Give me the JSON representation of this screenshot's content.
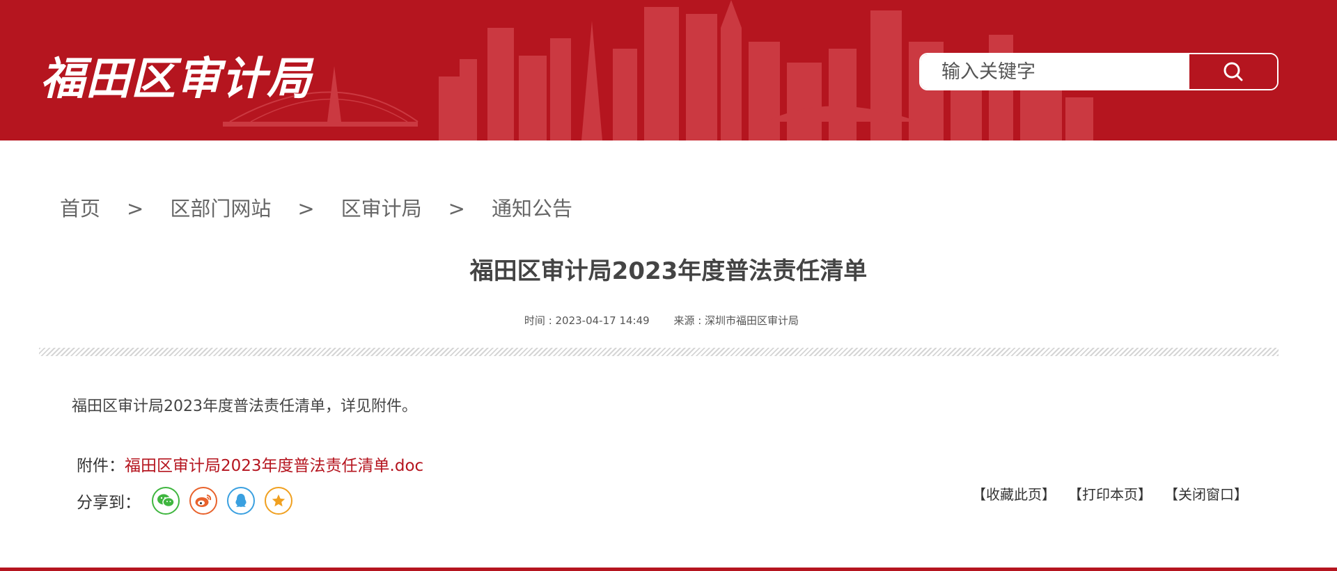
{
  "header": {
    "site_logo": "福田区审计局",
    "search": {
      "placeholder": "输入关键字"
    }
  },
  "breadcrumb": [
    {
      "label": "首页"
    },
    {
      "label": "区部门网站"
    },
    {
      "label": "区审计局"
    },
    {
      "label": "通知公告"
    }
  ],
  "breadcrumb_separator": ">",
  "article": {
    "title": "福田区审计局2023年度普法责任清单",
    "meta_time": "时间 : 2023-04-17 14:49",
    "meta_source": "来源 : 深圳市福田区审计局",
    "body": "福田区审计局2023年度普法责任清单，详见附件。",
    "attachment_label": "附件：",
    "attachment_link": "福田区审计局2023年度普法责任清单.doc",
    "share_label": "分享到："
  },
  "share_icons": [
    "wechat-icon",
    "weibo-icon",
    "qq-icon",
    "favorite-star-icon"
  ],
  "page_actions": {
    "bookmark": "【收藏此页】",
    "print": "【打印本页】",
    "close": "【关闭窗口】"
  },
  "colors": {
    "brand_red": "#b5151f",
    "link_red": "#b5151f",
    "wechat_green": "#3fb63f",
    "weibo_orange": "#e8622c",
    "qq_blue": "#3aa0e0",
    "favorite_gold": "#f0a020"
  }
}
